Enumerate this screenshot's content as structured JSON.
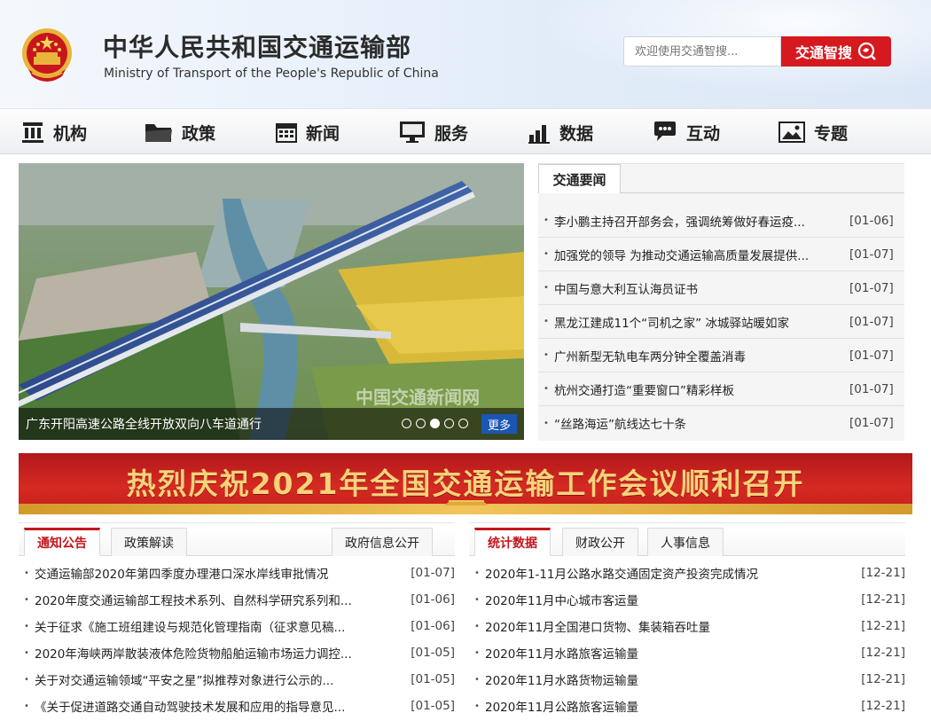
{
  "header": {
    "title": "中华人民共和国交通运输部",
    "subtitle": "Ministry of Transport of the People's Republic of China",
    "search_placeholder": "欢迎使用交通智搜...",
    "search_button": "交通智搜"
  },
  "nav": {
    "items": [
      {
        "label": "机构",
        "icon": "institution-icon"
      },
      {
        "label": "政策",
        "icon": "folder-icon"
      },
      {
        "label": "新闻",
        "icon": "calendar-icon"
      },
      {
        "label": "服务",
        "icon": "monitor-icon"
      },
      {
        "label": "数据",
        "icon": "bar-chart-icon"
      },
      {
        "label": "互动",
        "icon": "chat-icon"
      },
      {
        "label": "专题",
        "icon": "picture-icon"
      }
    ]
  },
  "slider": {
    "caption": "广东开阳高速公路全线开放双向八车道通行",
    "watermark": "中国交通新闻网",
    "more": "更多",
    "slide_count": 5,
    "active_slide": 3
  },
  "news": {
    "tab": "交通要闻",
    "items": [
      {
        "title": "李小鹏主持召开部务会，强调统筹做好春运疫...",
        "date": "[01-06]"
      },
      {
        "title": "加强党的领导 为推动交通运输高质量发展提供...",
        "date": "[01-07]"
      },
      {
        "title": "中国与意大利互认海员证书",
        "date": "[01-07]"
      },
      {
        "title": "黑龙江建成11个“司机之家” 冰城驿站暖如家",
        "date": "[01-07]"
      },
      {
        "title": "广州新型无轨电车两分钟全覆盖消毒",
        "date": "[01-07]"
      },
      {
        "title": "杭州交通打造“重要窗口”精彩样板",
        "date": "[01-07]"
      },
      {
        "title": "“丝路海运”航线达七十条",
        "date": "[01-07]"
      }
    ]
  },
  "banner": {
    "text": "热烈庆祝2021年全国交通运输工作会议顺利召开"
  },
  "left_panel": {
    "tabs": [
      "通知公告",
      "政策解读",
      "政府信息公开"
    ],
    "items": [
      {
        "title": "交通运输部2020年第四季度办理港口深水岸线审批情况",
        "date": "[01-07]"
      },
      {
        "title": "2020年度交通运输部工程技术系列、自然科学研究系列和...",
        "date": "[01-06]"
      },
      {
        "title": "关于征求《施工班组建设与规范化管理指南（征求意见稿...",
        "date": "[01-06]"
      },
      {
        "title": "2020年海峡两岸散装液体危险货物船舶运输市场运力调控...",
        "date": "[01-05]"
      },
      {
        "title": "关于对交通运输领域“平安之星”拟推荐对象进行公示的...",
        "date": "[01-05]"
      },
      {
        "title": "《关于促进道路交通自动驾驶技术发展和应用的指导意见...",
        "date": "[01-05]"
      }
    ]
  },
  "right_panel": {
    "tabs": [
      "统计数据",
      "财政公开",
      "人事信息"
    ],
    "items": [
      {
        "title": "2020年1-11月公路水路交通固定资产投资完成情况",
        "date": "[12-21]"
      },
      {
        "title": "2020年11月中心城市客运量",
        "date": "[12-21]"
      },
      {
        "title": "2020年11月全国港口货物、集装箱吞吐量",
        "date": "[12-21]"
      },
      {
        "title": "2020年11月水路旅客运输量",
        "date": "[12-21]"
      },
      {
        "title": "2020年11月水路货物运输量",
        "date": "[12-21]"
      },
      {
        "title": "2020年11月公路旅客运输量",
        "date": "[12-21]"
      }
    ]
  },
  "colors": {
    "brand_red": "#d6191f",
    "nav_text": "#222222",
    "link_blue": "#1c56b4"
  }
}
